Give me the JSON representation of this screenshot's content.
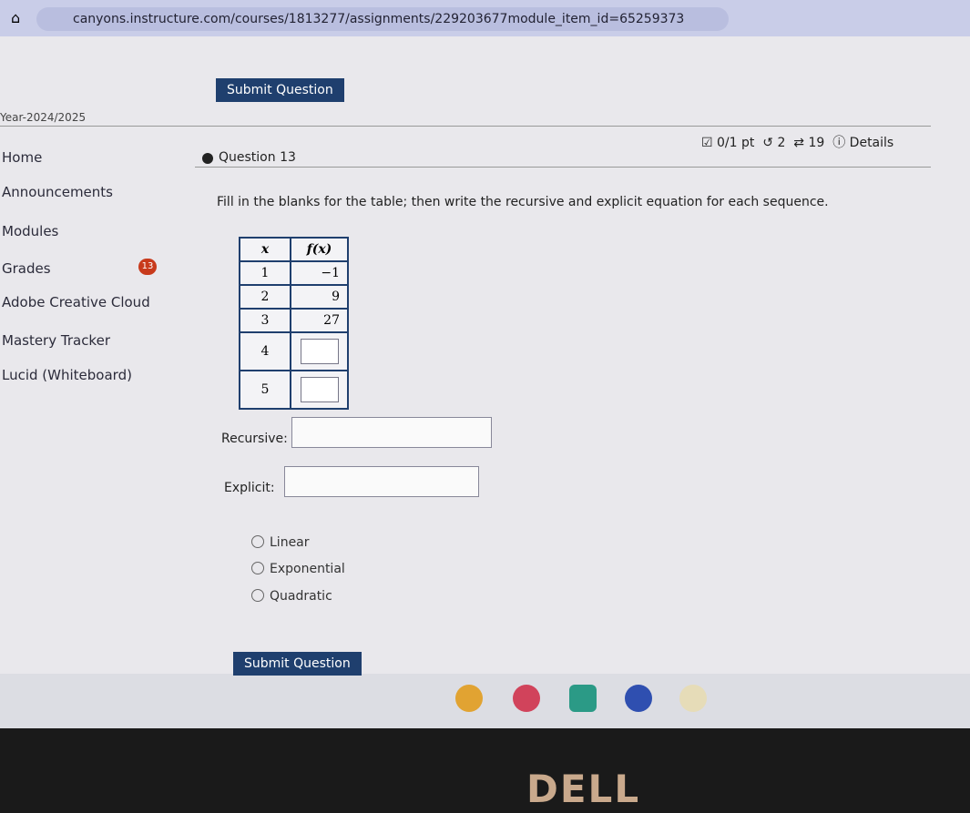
{
  "browser": {
    "url": "canyons.instructure.com/courses/1813277/assignments/229203677module_item_id=65259373"
  },
  "sidebar": {
    "year": "Year-2024/2025",
    "items": [
      {
        "label": "Home"
      },
      {
        "label": "Announcements"
      },
      {
        "label": "Modules"
      },
      {
        "label": "Grades",
        "badge": "13"
      },
      {
        "label": "Adobe Creative Cloud"
      },
      {
        "label": "Mastery Tracker"
      },
      {
        "label": "Lucid (Whiteboard)"
      }
    ]
  },
  "question": {
    "submit_top": "Submit Question",
    "title": "Question 13",
    "points": "0/1 pt",
    "retries": "2",
    "attempts": "19",
    "details": "Details",
    "prompt": "Fill in the blanks for the table; then write the recursive and explicit equation for each sequence.",
    "table": {
      "headers": [
        "x",
        "f(x)"
      ],
      "rows": [
        [
          "1",
          "−1"
        ],
        [
          "2",
          "9"
        ],
        [
          "3",
          "27"
        ],
        [
          "4",
          ""
        ],
        [
          "5",
          ""
        ]
      ]
    },
    "recursive_label": "Recursive:",
    "explicit_label": "Explicit:",
    "options": [
      "Linear",
      "Exponential",
      "Quadratic"
    ],
    "submit_bottom": "Submit Question"
  },
  "brand": "DELL"
}
